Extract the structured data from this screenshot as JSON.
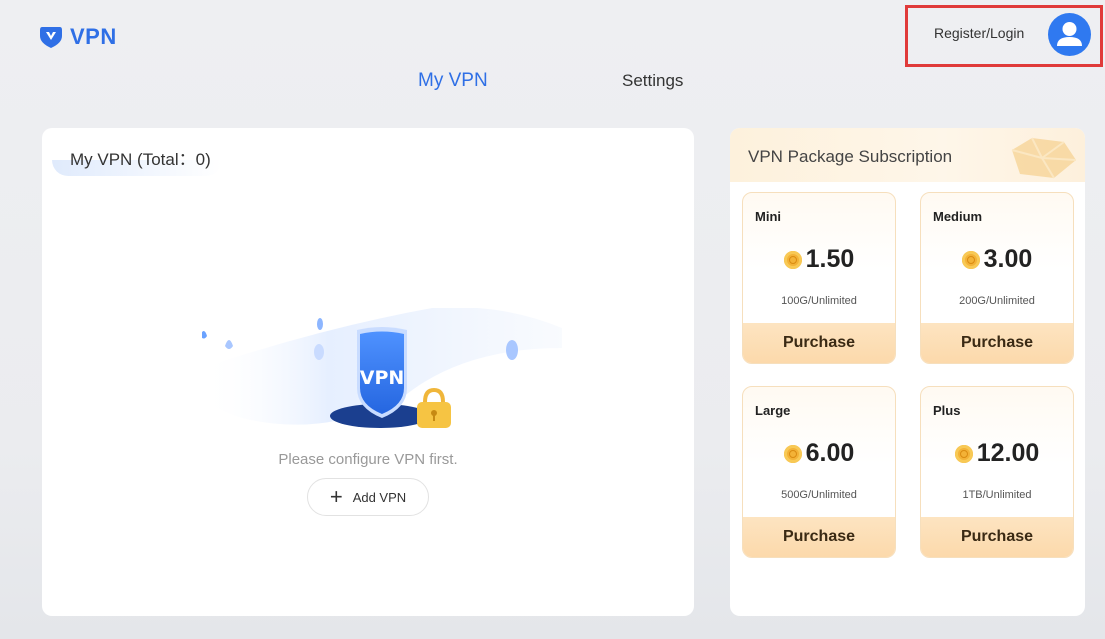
{
  "app": {
    "logo_text": "VPN"
  },
  "account": {
    "label": "Register/Login"
  },
  "tabs": [
    {
      "label": "My VPN",
      "active": true
    },
    {
      "label": "Settings",
      "active": false
    }
  ],
  "my_vpn": {
    "title": "My VPN (Total：0)",
    "empty_message": "Please configure VPN first.",
    "add_button_label": "Add VPN",
    "illustration_badge": "VPN"
  },
  "subscription": {
    "title": "VPN Package Subscription",
    "plans": [
      {
        "name": "Mini",
        "price": "1.50",
        "quota": "100G/Unlimited",
        "button": "Purchase"
      },
      {
        "name": "Medium",
        "price": "3.00",
        "quota": "200G/Unlimited",
        "button": "Purchase"
      },
      {
        "name": "Large",
        "price": "6.00",
        "quota": "500G/Unlimited",
        "button": "Purchase"
      },
      {
        "name": "Plus",
        "price": "12.00",
        "quota": "1TB/Unlimited",
        "button": "Purchase"
      }
    ]
  },
  "colors": {
    "accent": "#2f6fe6",
    "highlight_border": "#e03a3a",
    "purchase_bg": "#fcd9ab",
    "coin": "#f3b237"
  }
}
